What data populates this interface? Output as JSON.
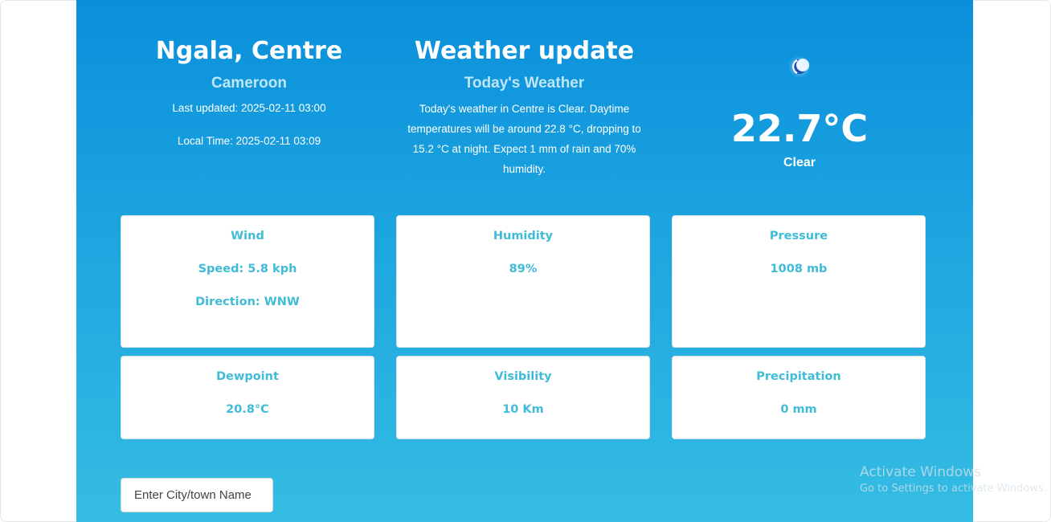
{
  "location": {
    "city": "Ngala, Centre",
    "country": "Cameroon",
    "last_updated": "Last updated: 2025-02-11 03:00",
    "local_time": "Local Time: 2025-02-11 03:09"
  },
  "update": {
    "title": "Weather update",
    "subtitle": "Today's Weather",
    "description": "Today's weather in Centre is Clear. Daytime temperatures will be around 22.8 °C, dropping to 15.2 °C at night. Expect 1 mm of rain and 70% humidity."
  },
  "current": {
    "icon": "moon-icon",
    "temperature": "22.7°C",
    "condition": "Clear"
  },
  "cards": {
    "wind": {
      "title": "Wind",
      "speed": "Speed: 5.8 kph",
      "direction": "Direction: WNW"
    },
    "humidity": {
      "title": "Humidity",
      "value": "89%"
    },
    "pressure": {
      "title": "Pressure",
      "value": "1008 mb"
    },
    "dewpoint": {
      "title": "Dewpoint",
      "value": "20.8°C"
    },
    "visibility": {
      "title": "Visibility",
      "value": "10 Km"
    },
    "precipitation": {
      "title": "Precipitation",
      "value": "0 mm"
    }
  },
  "search": {
    "placeholder": "Enter City/town Name"
  },
  "watermark": {
    "title": "Activate Windows",
    "subtitle": "Go to Settings to activate Windows."
  },
  "colors": {
    "panel_top": "#0a8fdb",
    "panel_bottom": "#35bde3",
    "card_text": "#3fbcd8",
    "subtitle": "#bfe6f8"
  }
}
